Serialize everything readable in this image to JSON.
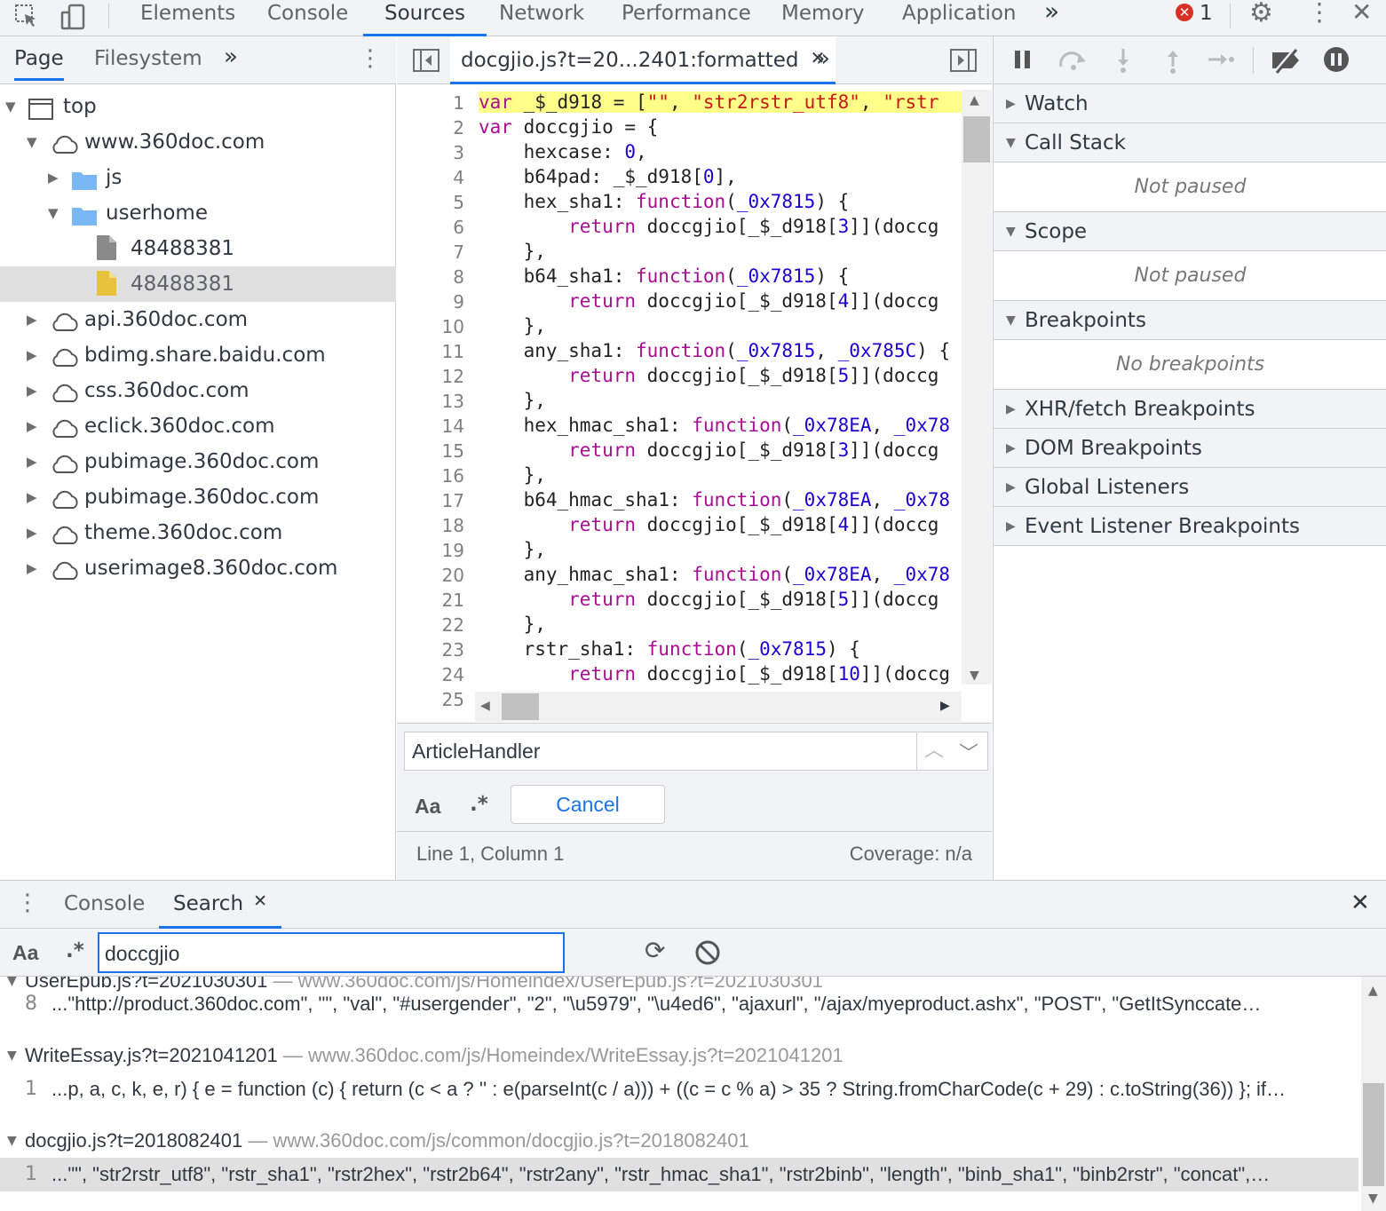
{
  "toolbar": {
    "tabs": [
      "Elements",
      "Console",
      "Sources",
      "Network",
      "Performance",
      "Memory",
      "Application"
    ],
    "more": "»",
    "error_count": "1"
  },
  "navigator": {
    "tabs": [
      "Page",
      "Filesystem"
    ],
    "more": "»",
    "tree": [
      {
        "label": "top",
        "depth": 0,
        "type": "frame",
        "open": true
      },
      {
        "label": "www.360doc.com",
        "depth": 1,
        "type": "domain",
        "open": true
      },
      {
        "label": "js",
        "depth": 2,
        "type": "folder",
        "open": false
      },
      {
        "label": "userhome",
        "depth": 2,
        "type": "folder",
        "open": true
      },
      {
        "label": "48488381",
        "depth": 3,
        "type": "file"
      },
      {
        "label": "48488381",
        "depth": 3,
        "type": "file-yellow",
        "selected": true
      },
      {
        "label": "api.360doc.com",
        "depth": 1,
        "type": "domain",
        "open": false
      },
      {
        "label": "bdimg.share.baidu.com",
        "depth": 1,
        "type": "domain",
        "open": false
      },
      {
        "label": "css.360doc.com",
        "depth": 1,
        "type": "domain",
        "open": false
      },
      {
        "label": "eclick.360doc.com",
        "depth": 1,
        "type": "domain",
        "open": false
      },
      {
        "label": "pubimage.360doc.com",
        "depth": 1,
        "type": "domain",
        "open": false
      },
      {
        "label": "pubimage.360doc.com",
        "depth": 1,
        "type": "domain",
        "open": false
      },
      {
        "label": "theme.360doc.com",
        "depth": 1,
        "type": "domain",
        "open": false
      },
      {
        "label": "userimage8.360doc.com",
        "depth": 1,
        "type": "domain",
        "open": false
      }
    ]
  },
  "editor": {
    "tab_label": "docgjio.js?t=20...2401:formatted",
    "more": "»",
    "lines": [
      [
        [
          "var",
          "kw"
        ],
        [
          " _$_d918 = [",
          ""
        ],
        [
          "\"\"",
          "str"
        ],
        [
          ", ",
          ""
        ],
        [
          "\"str2rstr_utf8\"",
          "str"
        ],
        [
          ", ",
          ""
        ],
        [
          "\"rstr",
          "str"
        ]
      ],
      [
        [
          "var",
          "kw"
        ],
        [
          " doccgjio = {",
          ""
        ]
      ],
      [
        [
          "    hexcase: ",
          ""
        ],
        [
          "0",
          "num"
        ],
        [
          ",",
          ""
        ]
      ],
      [
        [
          "    b64pad: _$_d918[",
          ""
        ],
        [
          "0",
          "num"
        ],
        [
          "],",
          ""
        ]
      ],
      [
        [
          "    hex_sha1: ",
          ""
        ],
        [
          "function",
          "kw"
        ],
        [
          "(",
          ""
        ],
        [
          "_0x7815",
          "fn"
        ],
        [
          ") {",
          ""
        ]
      ],
      [
        [
          "        ",
          ""
        ],
        [
          "return",
          "kw"
        ],
        [
          " doccgjio[_$_d918[",
          ""
        ],
        [
          "3",
          "num"
        ],
        [
          "]](doccg",
          ""
        ]
      ],
      [
        [
          "    },",
          ""
        ]
      ],
      [
        [
          "    b64_sha1: ",
          ""
        ],
        [
          "function",
          "kw"
        ],
        [
          "(",
          ""
        ],
        [
          "_0x7815",
          "fn"
        ],
        [
          ") {",
          ""
        ]
      ],
      [
        [
          "        ",
          ""
        ],
        [
          "return",
          "kw"
        ],
        [
          " doccgjio[_$_d918[",
          ""
        ],
        [
          "4",
          "num"
        ],
        [
          "]](doccg",
          ""
        ]
      ],
      [
        [
          "    },",
          ""
        ]
      ],
      [
        [
          "    any_sha1: ",
          ""
        ],
        [
          "function",
          "kw"
        ],
        [
          "(",
          ""
        ],
        [
          "_0x7815",
          "fn"
        ],
        [
          ", ",
          ""
        ],
        [
          "_0x785C",
          "fn"
        ],
        [
          ") {",
          ""
        ]
      ],
      [
        [
          "        ",
          ""
        ],
        [
          "return",
          "kw"
        ],
        [
          " doccgjio[_$_d918[",
          ""
        ],
        [
          "5",
          "num"
        ],
        [
          "]](doccg",
          ""
        ]
      ],
      [
        [
          "    },",
          ""
        ]
      ],
      [
        [
          "    hex_hmac_sha1: ",
          ""
        ],
        [
          "function",
          "kw"
        ],
        [
          "(",
          ""
        ],
        [
          "_0x78EA",
          "fn"
        ],
        [
          ", ",
          ""
        ],
        [
          "_0x78",
          "fn"
        ]
      ],
      [
        [
          "        ",
          ""
        ],
        [
          "return",
          "kw"
        ],
        [
          " doccgjio[_$_d918[",
          ""
        ],
        [
          "3",
          "num"
        ],
        [
          "]](doccg",
          ""
        ]
      ],
      [
        [
          "    },",
          ""
        ]
      ],
      [
        [
          "    b64_hmac_sha1: ",
          ""
        ],
        [
          "function",
          "kw"
        ],
        [
          "(",
          ""
        ],
        [
          "_0x78EA",
          "fn"
        ],
        [
          ", ",
          ""
        ],
        [
          "_0x78",
          "fn"
        ]
      ],
      [
        [
          "        ",
          ""
        ],
        [
          "return",
          "kw"
        ],
        [
          " doccgjio[_$_d918[",
          ""
        ],
        [
          "4",
          "num"
        ],
        [
          "]](doccg",
          ""
        ]
      ],
      [
        [
          "    },",
          ""
        ]
      ],
      [
        [
          "    any_hmac_sha1: ",
          ""
        ],
        [
          "function",
          "kw"
        ],
        [
          "(",
          ""
        ],
        [
          "_0x78EA",
          "fn"
        ],
        [
          ", ",
          ""
        ],
        [
          "_0x78",
          "fn"
        ]
      ],
      [
        [
          "        ",
          ""
        ],
        [
          "return",
          "kw"
        ],
        [
          " doccgjio[_$_d918[",
          ""
        ],
        [
          "5",
          "num"
        ],
        [
          "]](doccg",
          ""
        ]
      ],
      [
        [
          "    },",
          ""
        ]
      ],
      [
        [
          "    rstr_sha1: ",
          ""
        ],
        [
          "function",
          "kw"
        ],
        [
          "(",
          ""
        ],
        [
          "_0x7815",
          "fn"
        ],
        [
          ") {",
          ""
        ]
      ],
      [
        [
          "        ",
          ""
        ],
        [
          "return",
          "kw"
        ],
        [
          " doccgjio[_$_d918[",
          ""
        ],
        [
          "10",
          "num"
        ],
        [
          "]](doccg",
          ""
        ]
      ],
      [
        [
          "",
          ""
        ]
      ]
    ],
    "find_value": "ArticleHandler",
    "find_case": "Aa",
    "find_regex": ".*",
    "cancel_label": "Cancel",
    "status_position": "Line 1, Column 1",
    "status_coverage": "Coverage: n/a"
  },
  "debugger": {
    "sections": [
      {
        "label": "Watch",
        "open": false
      },
      {
        "label": "Call Stack",
        "open": true,
        "empty": "Not paused"
      },
      {
        "label": "Scope",
        "open": true,
        "empty": "Not paused"
      },
      {
        "label": "Breakpoints",
        "open": true,
        "empty": "No breakpoints"
      },
      {
        "label": "XHR/fetch Breakpoints",
        "open": false
      },
      {
        "label": "DOM Breakpoints",
        "open": false
      },
      {
        "label": "Global Listeners",
        "open": false
      },
      {
        "label": "Event Listener Breakpoints",
        "open": false
      }
    ]
  },
  "drawer": {
    "tabs": [
      "Console",
      "Search"
    ],
    "search_value": "doccgjio",
    "case_label": "Aa",
    "regex_label": ".*",
    "results": [
      {
        "kind": "clipped-header",
        "file": "UserEpub.js?t=2021030301",
        "path": "www.360doc.com/js/Homeindex/UserEpub.js?t=2021030301"
      },
      {
        "kind": "line",
        "num": "8",
        "text": "...\"http://product.360doc.com\", \"\", \"val\", \"#usergender\", \"2\", \"\\u5979\", \"\\u4ed6\", \"ajaxurl\", \"/ajax/myeproduct.ashx\", \"POST\", \"GetItSynccate…"
      },
      {
        "kind": "header",
        "file": "WriteEssay.js?t=2021041201",
        "path": "www.360doc.com/js/Homeindex/WriteEssay.js?t=2021041201"
      },
      {
        "kind": "line",
        "num": "1",
        "text": "...p, a, c, k, e, r) { e = function (c) { return (c < a ? '' : e(parseInt(c / a))) + ((c = c % a) > 35 ? String.fromCharCode(c + 29) : c.toString(36)) }; if…"
      },
      {
        "kind": "header",
        "file": "docgjio.js?t=2018082401",
        "path": "www.360doc.com/js/common/docgjio.js?t=2018082401"
      },
      {
        "kind": "line-selected",
        "num": "1",
        "text": "...\"\", \"str2rstr_utf8\", \"rstr_sha1\", \"rstr2hex\", \"rstr2b64\", \"rstr2any\", \"rstr_hmac_sha1\", \"rstr2binb\", \"length\", \"binb_sha1\", \"binb2rstr\", \"concat\",…"
      }
    ]
  }
}
